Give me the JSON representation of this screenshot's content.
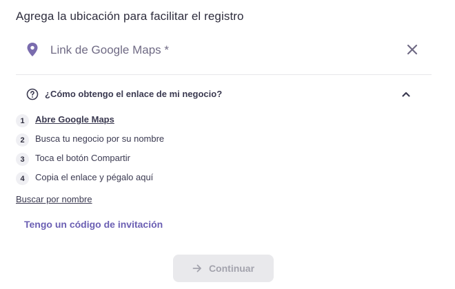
{
  "title": "Agrega la ubicación para facilitar el registro",
  "location_input": {
    "placeholder": "Link de Google Maps *",
    "value": ""
  },
  "help": {
    "question": "¿Cómo obtengo el enlace de mi negocio?"
  },
  "steps": [
    {
      "number": "1",
      "text": "Abre Google Maps"
    },
    {
      "number": "2",
      "text": "Busca tu negocio por su nombre"
    },
    {
      "number": "3",
      "text": "Toca el botón Compartir"
    },
    {
      "number": "4",
      "text": "Copia el enlace y pégalo aquí"
    }
  ],
  "search_by_name_label": "Buscar por nombre",
  "invite_code_label": "Tengo un código de invitación",
  "continue_label": "Continuar",
  "colors": {
    "accent": "#6b5fb3",
    "pin": "#7a6cae",
    "text": "#2e2d3d",
    "disabled_bg": "#e9e9ec",
    "disabled_text": "#a3a3ad"
  },
  "icons": {
    "location": "map-pin-icon",
    "clear": "close-icon",
    "help": "question-circle-icon",
    "collapse": "chevron-up-icon",
    "continue": "arrow-right-icon"
  }
}
